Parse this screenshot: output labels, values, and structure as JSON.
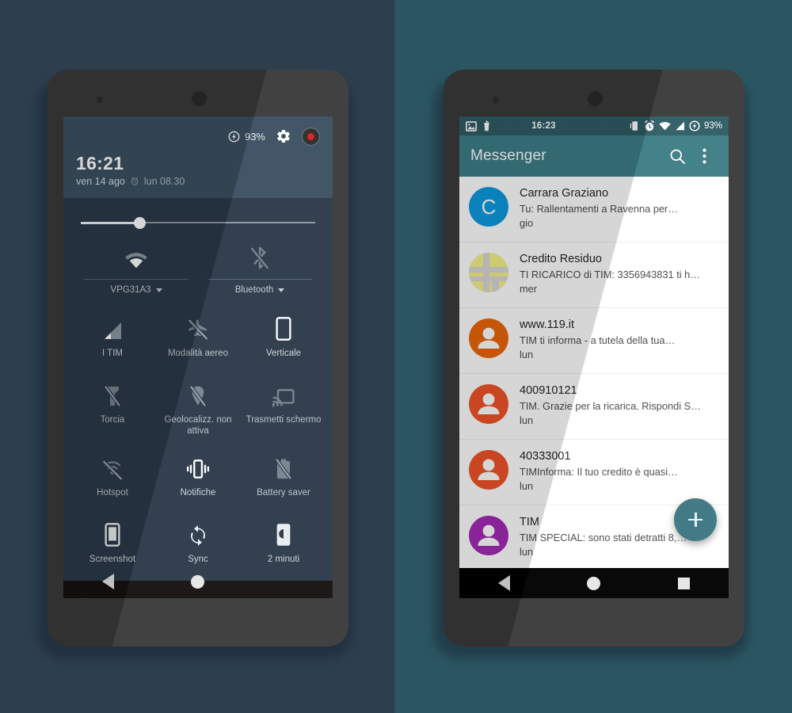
{
  "background": {
    "left_color": "#2d3e4f",
    "right_color": "#2a5561"
  },
  "left_phone": {
    "name": "android-quick-settings-phone",
    "status": {
      "battery_percent": "93%",
      "charging_icon": "charging-bolt-icon",
      "settings_icon": "gear-icon",
      "record_icon": "screen-record-button"
    },
    "clock": {
      "time": "16:21",
      "date": "ven 14 ago",
      "alarm_icon": "alarm-clock-icon",
      "alarm": "lun 08.30"
    },
    "brightness": {
      "label": "brightness-slider",
      "value_percent": 25
    },
    "duo_tiles": [
      {
        "icon": "wifi-icon",
        "label": "VPG31A3",
        "state": "on"
      },
      {
        "icon": "bluetooth-off-icon",
        "label": "Bluetooth",
        "state": "off"
      }
    ],
    "tiles": [
      {
        "icon": "cellular-signal-icon",
        "label": "I TIM",
        "state": "on"
      },
      {
        "icon": "airplane-off-icon",
        "label": "Modalità aereo",
        "state": "off"
      },
      {
        "icon": "screen-rotation-portrait-icon",
        "label": "Verticale",
        "state": "on"
      },
      {
        "icon": "flashlight-off-icon",
        "label": "Torcia",
        "state": "off"
      },
      {
        "icon": "location-off-icon",
        "label": "Geolocalizz. non attiva",
        "state": "off"
      },
      {
        "icon": "cast-screen-icon",
        "label": "Trasmetti schermo",
        "state": "off"
      },
      {
        "icon": "hotspot-off-icon",
        "label": "Hotspot",
        "state": "off"
      },
      {
        "icon": "vibrate-icon",
        "label": "Notifiche",
        "state": "on"
      },
      {
        "icon": "battery-saver-off-icon",
        "label": "Battery saver",
        "state": "off"
      },
      {
        "icon": "screenshot-icon",
        "label": "Screenshot",
        "state": "on"
      },
      {
        "icon": "sync-icon",
        "label": "Sync",
        "state": "on"
      },
      {
        "icon": "screen-timeout-icon",
        "label": "2 minuti",
        "state": "on"
      }
    ],
    "nav": {
      "back": "back-button",
      "home": "home-button",
      "recents": "recents-button"
    }
  },
  "right_phone": {
    "name": "android-messenger-phone",
    "status": {
      "notif_icons": [
        "image-notification-icon",
        "drink-notification-icon"
      ],
      "time": "16:23",
      "right_icons": [
        "vibrate-icon",
        "alarm-clock-icon",
        "wifi-icon",
        "cellular-signal-icon",
        "charging-bolt-icon"
      ],
      "battery_percent": "93%"
    },
    "appbar": {
      "title": "Messenger",
      "search_icon": "search-icon",
      "overflow_icon": "more-vertical-icon"
    },
    "conversations": [
      {
        "avatar_type": "letter",
        "avatar_letter": "C",
        "avatar_color": "#0d9ae0",
        "name": "Carrara Graziano",
        "snippet": "Tu: Rallentamenti a Ravenna per…",
        "date": "gio"
      },
      {
        "avatar_type": "pattern",
        "avatar_letter": "",
        "avatar_color": "#f4f08a",
        "name": "Credito Residuo",
        "snippet": "TI RICARICO di TIM: 3356943831 ti h…",
        "date": "mer"
      },
      {
        "avatar_type": "person",
        "avatar_letter": "",
        "avatar_color": "#ec6608",
        "name": "www.119.it",
        "snippet": "TIM ti informa - a tutela della tua…",
        "date": "lun"
      },
      {
        "avatar_type": "person",
        "avatar_letter": "",
        "avatar_color": "#f0542a",
        "name": "400910121",
        "snippet": "TIM. Grazie per la ricarica. Rispondi S…",
        "date": "lun"
      },
      {
        "avatar_type": "person",
        "avatar_letter": "",
        "avatar_color": "#f0542a",
        "name": "40333001",
        "snippet": "TIMInforma: Il tuo credito è quasi…",
        "date": "lun"
      },
      {
        "avatar_type": "person",
        "avatar_letter": "",
        "avatar_color": "#a32bb5",
        "name": "TIM",
        "snippet": "TIM SPECIAL: sono stati detratti 8,…",
        "date": "lun"
      }
    ],
    "fab": {
      "icon": "plus-icon",
      "label": "new-conversation-button",
      "color": "#3b7682"
    },
    "nav": {
      "back": "back-button",
      "home": "home-button",
      "recents": "recents-button"
    }
  }
}
